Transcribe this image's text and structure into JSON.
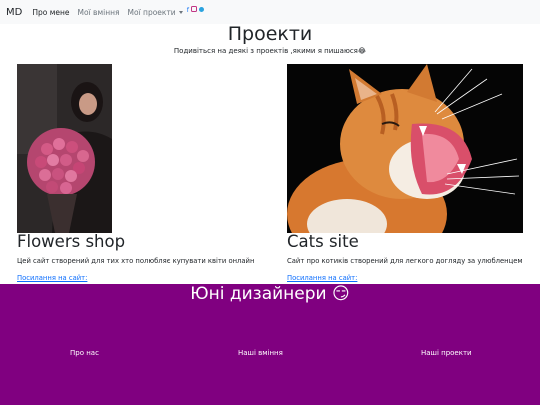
{
  "nav": {
    "brand": "MD",
    "items": [
      {
        "label": "Про мене"
      },
      {
        "label": "Мої вміння"
      },
      {
        "label": "Мої проекти"
      }
    ],
    "social_icons": [
      "facebook-icon",
      "instagram-icon",
      "telegram-icon"
    ]
  },
  "main": {
    "title": "Проекти",
    "subtitle": "Подивіться на деякі з проектів ,якими я пишаюся😂"
  },
  "projects": [
    {
      "title": "Flowers shop",
      "text": "Цей сайт створений для тих хто полюбляє купувати квіти онлайн",
      "link": "Посилання на сайт:"
    },
    {
      "title": "Cats site",
      "text": "Сайт про котиків створений для легкого догляду за улюбленцем",
      "link": "Посилання на сайт:"
    }
  ],
  "footer": {
    "title": "Юні дизайнери 😏",
    "links": [
      {
        "label": "Про нас"
      },
      {
        "label": "Наші вміння"
      },
      {
        "label": "Наші проекти"
      }
    ]
  },
  "colors": {
    "footer_bg": "#800080",
    "link": "#0d6efd",
    "navbar_bg": "#f8f9fa"
  }
}
